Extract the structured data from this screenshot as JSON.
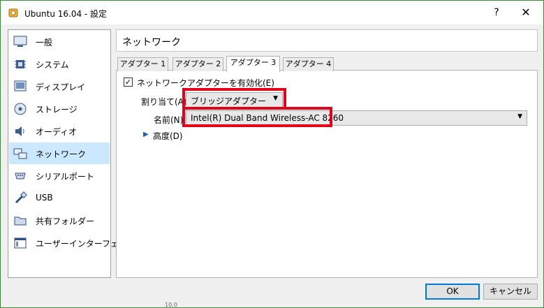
{
  "window": {
    "title": "Ubuntu 16.04 - 設定",
    "help_glyph": "?",
    "close_glyph": "✕"
  },
  "sidebar": {
    "items": [
      {
        "label": "一般",
        "icon": "monitor-icon",
        "selected": false
      },
      {
        "label": "システム",
        "icon": "chip-icon",
        "selected": false
      },
      {
        "label": "ディスプレイ",
        "icon": "display-icon",
        "selected": false
      },
      {
        "label": "ストレージ",
        "icon": "disk-icon",
        "selected": false
      },
      {
        "label": "オーディオ",
        "icon": "speaker-icon",
        "selected": false
      },
      {
        "label": "ネットワーク",
        "icon": "network-icon",
        "selected": true
      },
      {
        "label": "シリアルポート",
        "icon": "serial-port-icon",
        "selected": false
      },
      {
        "label": "USB",
        "icon": "usb-icon",
        "selected": false
      },
      {
        "label": "共有フォルダー",
        "icon": "folder-icon",
        "selected": false
      },
      {
        "label": "ユーザーインターフェース",
        "icon": "window-icon",
        "selected": false
      }
    ]
  },
  "header": {
    "title": "ネットワーク"
  },
  "tabs": [
    {
      "label": "アダプター 1",
      "active": false
    },
    {
      "label": "アダプター 2",
      "active": false
    },
    {
      "label": "アダプター 3",
      "active": true
    },
    {
      "label": "アダプター 4",
      "active": false
    }
  ],
  "adapter": {
    "enable_label": "ネットワークアダプターを有効化(E)",
    "enabled": true,
    "check_glyph": "✓",
    "attached_label": "割り当て(A):",
    "attached_value": "ブリッジアダプター",
    "name_label": "名前(N):",
    "name_value": "Intel(R) Dual Band Wireless-AC 8260",
    "advanced_label": "高度(D)",
    "arrow_glyph": "▼",
    "expander_glyph": "▶"
  },
  "buttons": {
    "ok": "OK",
    "cancel": "キャンセル"
  },
  "corner_text": "10.0",
  "colors": {
    "accent": "#0078d7",
    "selection": "#cce8ff",
    "highlight_box": "#e3001b"
  }
}
